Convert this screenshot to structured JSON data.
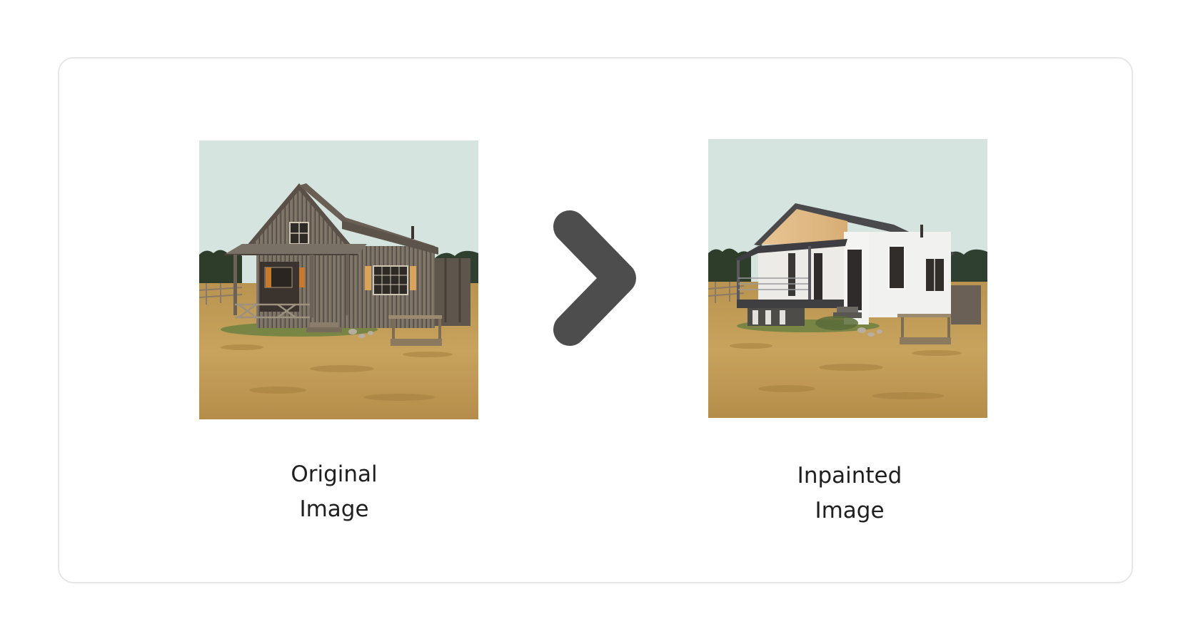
{
  "panel": {
    "background": "#ffffff",
    "border_color": "#e6e6e6"
  },
  "original": {
    "caption_line1": "Original",
    "caption_line2": "Image",
    "image": "rustic-weathered-wooden-cabin-photo"
  },
  "inpainted": {
    "caption_line1": "Inpainted",
    "caption_line2": "Image",
    "image": "modern-white-house-photo"
  },
  "arrow": {
    "icon": "chevron-right-icon",
    "color": "#4d4d4d"
  },
  "colors": {
    "sky": "#d6e4e0",
    "dry_grass": "#c9a35a",
    "caption_text": "#1f1f1f"
  }
}
